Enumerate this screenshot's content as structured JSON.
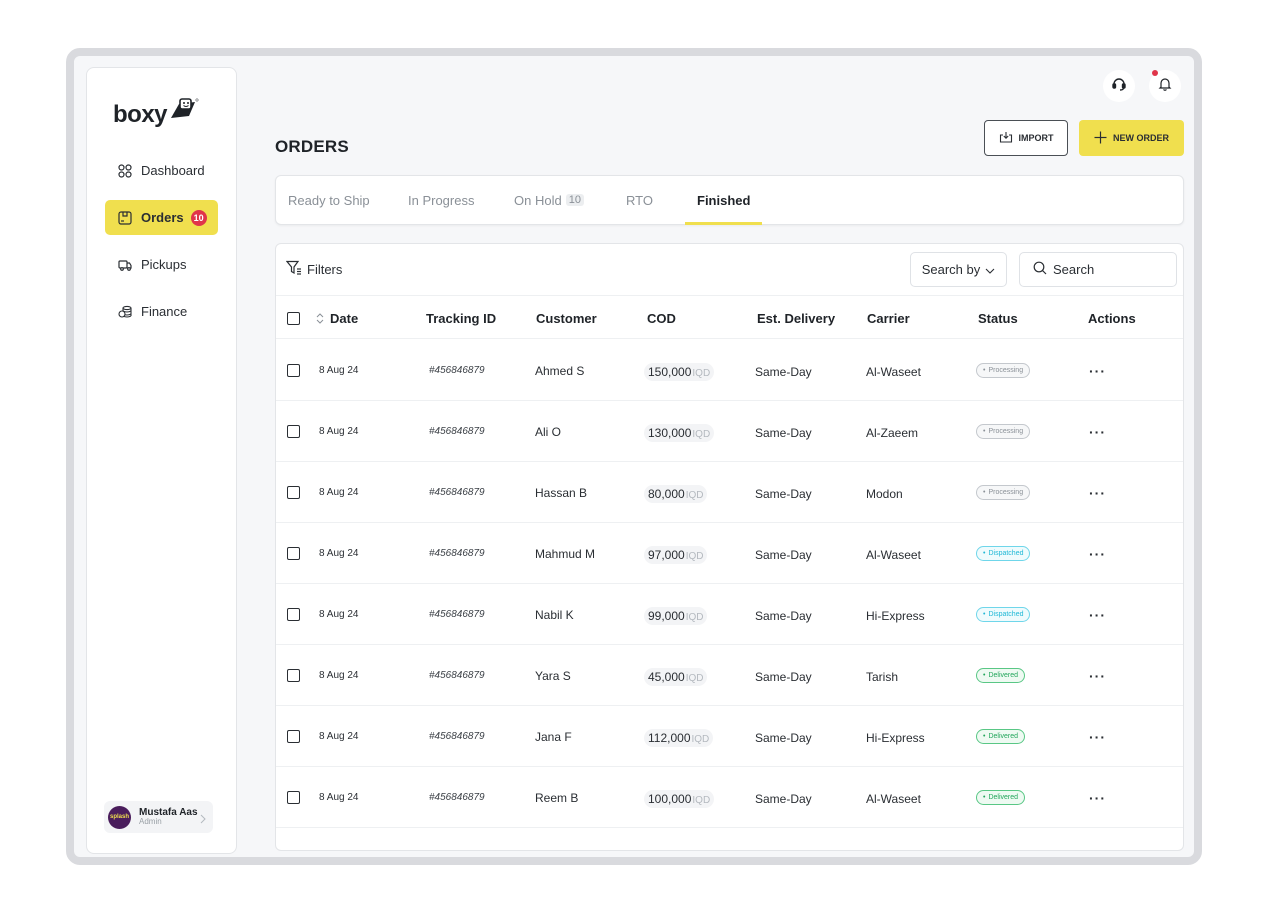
{
  "app": {
    "logo_text": "boxy"
  },
  "sidebar": {
    "items": [
      {
        "label": "Dashboard",
        "icon": "grid-icon",
        "active": false,
        "badge": ""
      },
      {
        "label": "Orders",
        "icon": "box-icon",
        "active": true,
        "badge": "10"
      },
      {
        "label": "Pickups",
        "icon": "truck-icon",
        "active": false,
        "badge": ""
      },
      {
        "label": "Finance",
        "icon": "coins-icon",
        "active": false,
        "badge": ""
      }
    ],
    "user": {
      "name": "Mustafa Aas",
      "role": "Admin",
      "avatar_text": "splash"
    }
  },
  "header": {
    "title": "ORDERS",
    "import_label": "IMPORT",
    "new_order_label": "NEW ORDER"
  },
  "tabs": [
    {
      "label": "Ready to Ship",
      "count": "",
      "active": false
    },
    {
      "label": "In Progress",
      "count": "",
      "active": false
    },
    {
      "label": "On Hold",
      "count": "10",
      "active": false
    },
    {
      "label": "RTO",
      "count": "",
      "active": false
    },
    {
      "label": "Finished",
      "count": "",
      "active": true
    }
  ],
  "toolbar": {
    "filters_label": "Filters",
    "search_by_label": "Search by",
    "search_placeholder": "Search"
  },
  "table": {
    "columns": [
      "Date",
      "Tracking ID",
      "Customer",
      "COD",
      "Est. Delivery",
      "Carrier",
      "Status",
      "Actions"
    ],
    "currency": "IQD",
    "rows": [
      {
        "date": "8 Aug 24",
        "tracking": "#456846879",
        "customer": "Ahmed S",
        "cod": "150,000",
        "delivery": "Same-Day",
        "carrier": "Al-Waseet",
        "status": "Processing"
      },
      {
        "date": "8 Aug 24",
        "tracking": "#456846879",
        "customer": "Ali O",
        "cod": "130,000",
        "delivery": "Same-Day",
        "carrier": "Al-Zaeem",
        "status": "Processing"
      },
      {
        "date": "8 Aug 24",
        "tracking": "#456846879",
        "customer": "Hassan B",
        "cod": "80,000",
        "delivery": "Same-Day",
        "carrier": "Modon",
        "status": "Processing"
      },
      {
        "date": "8 Aug 24",
        "tracking": "#456846879",
        "customer": "Mahmud M",
        "cod": "97,000",
        "delivery": "Same-Day",
        "carrier": "Al-Waseet",
        "status": "Dispatched"
      },
      {
        "date": "8 Aug 24",
        "tracking": "#456846879",
        "customer": "Nabil K",
        "cod": "99,000",
        "delivery": "Same-Day",
        "carrier": "Hi-Express",
        "status": "Dispatched"
      },
      {
        "date": "8 Aug 24",
        "tracking": "#456846879",
        "customer": "Yara S",
        "cod": "45,000",
        "delivery": "Same-Day",
        "carrier": "Tarish",
        "status": "Delivered"
      },
      {
        "date": "8 Aug 24",
        "tracking": "#456846879",
        "customer": "Jana F",
        "cod": "112,000",
        "delivery": "Same-Day",
        "carrier": "Hi-Express",
        "status": "Delivered"
      },
      {
        "date": "8 Aug 24",
        "tracking": "#456846879",
        "customer": "Reem B",
        "cod": "100,000",
        "delivery": "Same-Day",
        "carrier": "Al-Waseet",
        "status": "Delivered"
      }
    ]
  },
  "colors": {
    "accent": "#f0df4e",
    "badge": "#e0354a",
    "processing": "#8a9097",
    "dispatched": "#1fb8d6",
    "delivered": "#21a65a"
  }
}
